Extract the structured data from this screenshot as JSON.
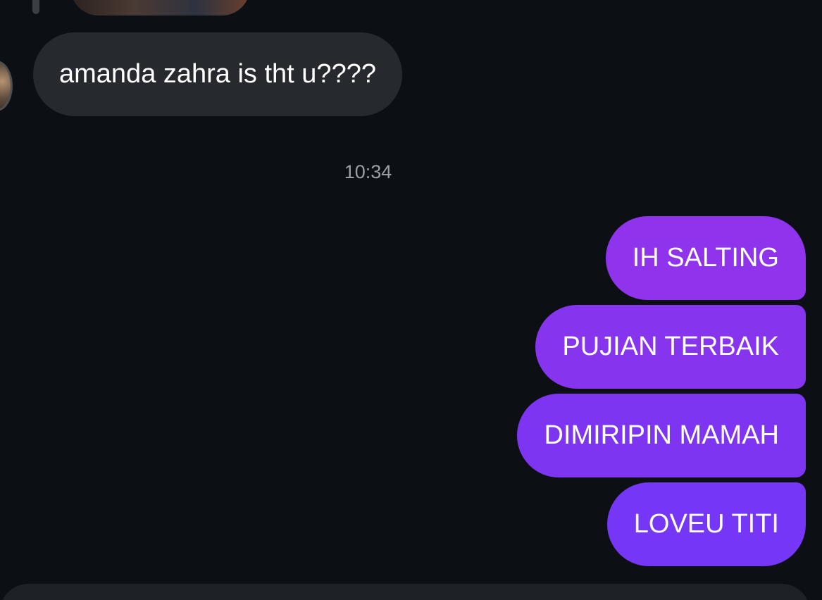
{
  "thread": {
    "incoming_message": "amanda zahra is tht u????",
    "timestamp": "10:34",
    "outgoing_messages": [
      "IH SALTING",
      "PUJIAN TERBAIK",
      "DIMIRIPIN MAMAH",
      "LOVEU TITI"
    ]
  },
  "colors": {
    "background": "#0c1014",
    "incoming_bubble": "#262a2e",
    "outgoing_bubble_top": "#8f33ec",
    "outgoing_bubble_bottom": "#7536f5",
    "timestamp_text": "#9aa0a6"
  }
}
